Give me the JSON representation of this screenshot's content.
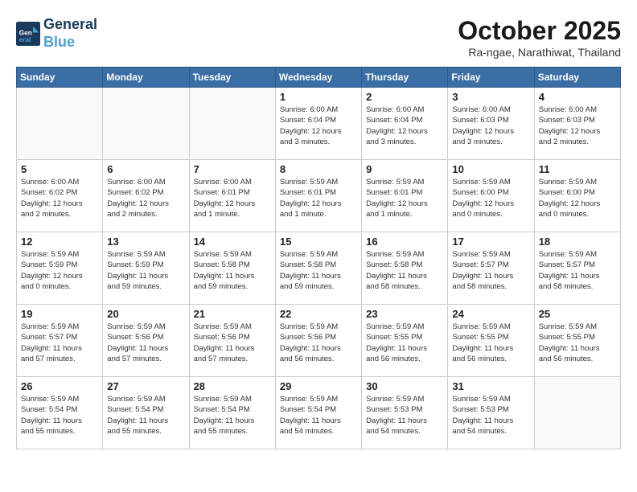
{
  "header": {
    "logo_line1": "General",
    "logo_line2": "Blue",
    "month": "October 2025",
    "location": "Ra-ngae, Narathiwat, Thailand"
  },
  "weekdays": [
    "Sunday",
    "Monday",
    "Tuesday",
    "Wednesday",
    "Thursday",
    "Friday",
    "Saturday"
  ],
  "weeks": [
    [
      {
        "day": "",
        "info": ""
      },
      {
        "day": "",
        "info": ""
      },
      {
        "day": "",
        "info": ""
      },
      {
        "day": "1",
        "info": "Sunrise: 6:00 AM\nSunset: 6:04 PM\nDaylight: 12 hours\nand 3 minutes."
      },
      {
        "day": "2",
        "info": "Sunrise: 6:00 AM\nSunset: 6:04 PM\nDaylight: 12 hours\nand 3 minutes."
      },
      {
        "day": "3",
        "info": "Sunrise: 6:00 AM\nSunset: 6:03 PM\nDaylight: 12 hours\nand 3 minutes."
      },
      {
        "day": "4",
        "info": "Sunrise: 6:00 AM\nSunset: 6:03 PM\nDaylight: 12 hours\nand 2 minutes."
      }
    ],
    [
      {
        "day": "5",
        "info": "Sunrise: 6:00 AM\nSunset: 6:02 PM\nDaylight: 12 hours\nand 2 minutes."
      },
      {
        "day": "6",
        "info": "Sunrise: 6:00 AM\nSunset: 6:02 PM\nDaylight: 12 hours\nand 2 minutes."
      },
      {
        "day": "7",
        "info": "Sunrise: 6:00 AM\nSunset: 6:01 PM\nDaylight: 12 hours\nand 1 minute."
      },
      {
        "day": "8",
        "info": "Sunrise: 5:59 AM\nSunset: 6:01 PM\nDaylight: 12 hours\nand 1 minute."
      },
      {
        "day": "9",
        "info": "Sunrise: 5:59 AM\nSunset: 6:01 PM\nDaylight: 12 hours\nand 1 minute."
      },
      {
        "day": "10",
        "info": "Sunrise: 5:59 AM\nSunset: 6:00 PM\nDaylight: 12 hours\nand 0 minutes."
      },
      {
        "day": "11",
        "info": "Sunrise: 5:59 AM\nSunset: 6:00 PM\nDaylight: 12 hours\nand 0 minutes."
      }
    ],
    [
      {
        "day": "12",
        "info": "Sunrise: 5:59 AM\nSunset: 5:59 PM\nDaylight: 12 hours\nand 0 minutes."
      },
      {
        "day": "13",
        "info": "Sunrise: 5:59 AM\nSunset: 5:59 PM\nDaylight: 11 hours\nand 59 minutes."
      },
      {
        "day": "14",
        "info": "Sunrise: 5:59 AM\nSunset: 5:58 PM\nDaylight: 11 hours\nand 59 minutes."
      },
      {
        "day": "15",
        "info": "Sunrise: 5:59 AM\nSunset: 5:58 PM\nDaylight: 11 hours\nand 59 minutes."
      },
      {
        "day": "16",
        "info": "Sunrise: 5:59 AM\nSunset: 5:58 PM\nDaylight: 11 hours\nand 58 minutes."
      },
      {
        "day": "17",
        "info": "Sunrise: 5:59 AM\nSunset: 5:57 PM\nDaylight: 11 hours\nand 58 minutes."
      },
      {
        "day": "18",
        "info": "Sunrise: 5:59 AM\nSunset: 5:57 PM\nDaylight: 11 hours\nand 58 minutes."
      }
    ],
    [
      {
        "day": "19",
        "info": "Sunrise: 5:59 AM\nSunset: 5:57 PM\nDaylight: 11 hours\nand 57 minutes."
      },
      {
        "day": "20",
        "info": "Sunrise: 5:59 AM\nSunset: 5:56 PM\nDaylight: 11 hours\nand 57 minutes."
      },
      {
        "day": "21",
        "info": "Sunrise: 5:59 AM\nSunset: 5:56 PM\nDaylight: 11 hours\nand 57 minutes."
      },
      {
        "day": "22",
        "info": "Sunrise: 5:59 AM\nSunset: 5:56 PM\nDaylight: 11 hours\nand 56 minutes."
      },
      {
        "day": "23",
        "info": "Sunrise: 5:59 AM\nSunset: 5:55 PM\nDaylight: 11 hours\nand 56 minutes."
      },
      {
        "day": "24",
        "info": "Sunrise: 5:59 AM\nSunset: 5:55 PM\nDaylight: 11 hours\nand 56 minutes."
      },
      {
        "day": "25",
        "info": "Sunrise: 5:59 AM\nSunset: 5:55 PM\nDaylight: 11 hours\nand 56 minutes."
      }
    ],
    [
      {
        "day": "26",
        "info": "Sunrise: 5:59 AM\nSunset: 5:54 PM\nDaylight: 11 hours\nand 55 minutes."
      },
      {
        "day": "27",
        "info": "Sunrise: 5:59 AM\nSunset: 5:54 PM\nDaylight: 11 hours\nand 55 minutes."
      },
      {
        "day": "28",
        "info": "Sunrise: 5:59 AM\nSunset: 5:54 PM\nDaylight: 11 hours\nand 55 minutes."
      },
      {
        "day": "29",
        "info": "Sunrise: 5:59 AM\nSunset: 5:54 PM\nDaylight: 11 hours\nand 54 minutes."
      },
      {
        "day": "30",
        "info": "Sunrise: 5:59 AM\nSunset: 5:53 PM\nDaylight: 11 hours\nand 54 minutes."
      },
      {
        "day": "31",
        "info": "Sunrise: 5:59 AM\nSunset: 5:53 PM\nDaylight: 11 hours\nand 54 minutes."
      },
      {
        "day": "",
        "info": ""
      }
    ]
  ]
}
